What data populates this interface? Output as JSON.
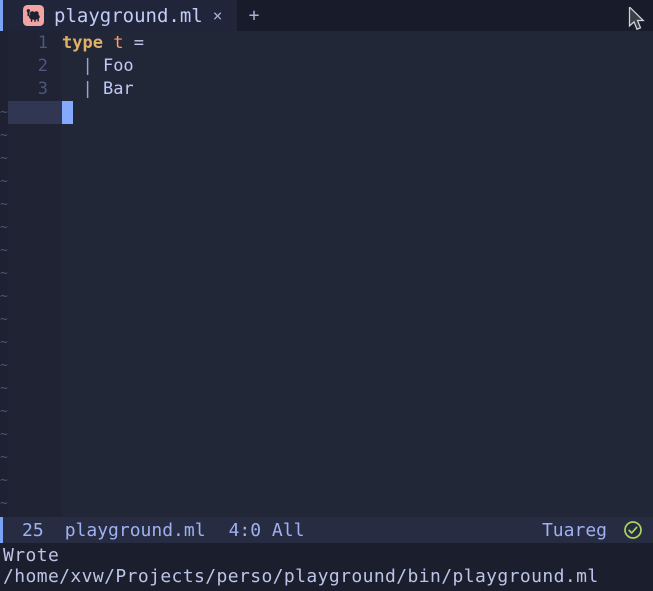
{
  "colors": {
    "accent_blue": "#7aa2f7",
    "cursor_blue": "#85a9ff",
    "keyword_yellow": "#e0af68",
    "type_orange": "#ff9e64",
    "foreground": "#c0caf5",
    "check_green": "#a9d65c",
    "tab_icon_pink": "#f0a4a4"
  },
  "tab_bar": {
    "active_tab": {
      "label": "playground.ml",
      "close_glyph": "×",
      "icon": "ocaml-camel-icon"
    },
    "new_tab_glyph": "+"
  },
  "editor": {
    "lines": [
      {
        "number": "1",
        "segments": [
          {
            "text": "type",
            "style": "keyword"
          },
          {
            "text": " ",
            "style": "plain"
          },
          {
            "text": "t",
            "style": "type-name"
          },
          {
            "text": " = ",
            "style": "plain"
          }
        ]
      },
      {
        "number": "2",
        "segments": [
          {
            "text": "  | ",
            "style": "punct"
          },
          {
            "text": "Foo",
            "style": "plain"
          }
        ]
      },
      {
        "number": "3",
        "segments": [
          {
            "text": "  | ",
            "style": "punct"
          },
          {
            "text": "Bar",
            "style": "plain"
          }
        ]
      }
    ],
    "empty_line_glyph": "~",
    "empty_line_count": 18,
    "cursor": {
      "line": "4",
      "column": "0"
    }
  },
  "modeline": {
    "left_value": "25",
    "buffer_name": "playground.ml",
    "cursor_position": "4:0",
    "scroll_position": "All",
    "position_text": "4:0 All",
    "major_mode": "Tuareg",
    "status_icon": "check-circle-icon"
  },
  "echo_area": {
    "message_lines": [
      "Wrote",
      "/home/xvw/Projects/perso/playground/bin/playground.ml"
    ]
  }
}
